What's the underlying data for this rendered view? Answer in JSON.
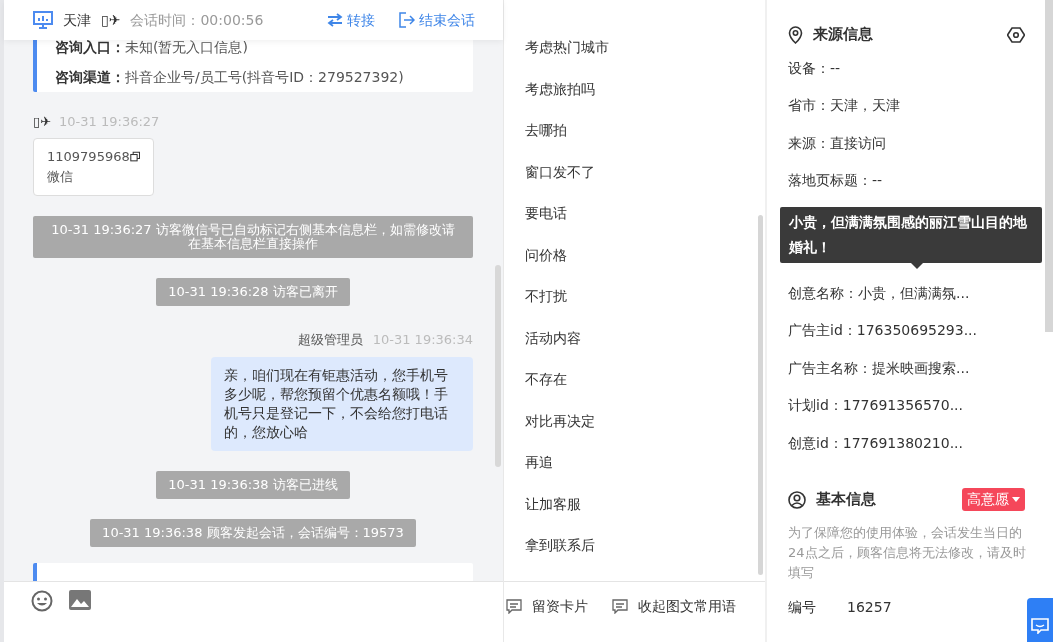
{
  "header": {
    "city": "天津",
    "visitor": "▯✈",
    "session_time": "会话时间：00:00:56",
    "actions": [
      {
        "label": "转接",
        "kind": "transfer"
      },
      {
        "label": "结束会话",
        "kind": "end"
      }
    ]
  },
  "messages": [
    {
      "kind": "info_card",
      "lines": [
        "**咨询入口：**未知(暂无入口信息)",
        "**咨询渠道：**抖音企业号/员工号(抖音号ID：279527392)"
      ]
    },
    {
      "kind": "visitor",
      "sender": "▯✈",
      "time": "10-31 19:36:27",
      "card": {
        "number": "1109795968",
        "label": "微信"
      }
    },
    {
      "kind": "system",
      "text": "10-31 19:36:27 访客微信号已自动标记右侧基本信息栏，如需修改请在基本信息栏直接操作"
    },
    {
      "kind": "system",
      "text": "10-31 19:36:28 访客已离开"
    },
    {
      "kind": "agent",
      "sender": "超级管理员",
      "time": "10-31 19:36:34",
      "text": "亲，咱们现在有钜惠活动，您手机号多少呢，帮您预留个优惠名额哦！手机号只是登记一下，不会给您打电话的，您放心哈"
    },
    {
      "kind": "system",
      "text": "10-31 19:36:38 访客已进线"
    },
    {
      "kind": "system",
      "text": "10-31 19:36:38 顾客发起会话，会话编号：19573"
    },
    {
      "kind": "info_card"
    }
  ],
  "phrases": [
    "考虑热门城市",
    "考虑旅拍吗",
    "去哪拍",
    "窗口发不了",
    "要电话",
    "问价格",
    "不打扰",
    "活动内容",
    "不存在",
    "对比再决定",
    "再追",
    "让加客服",
    "拿到联系后"
  ],
  "phrase_tools": [
    "留资卡片",
    "收起图文常用语"
  ],
  "source_info": {
    "title": "来源信息",
    "fields": [
      "设备：--",
      "省市：天津，天津",
      "来源：直接访问",
      "落地页标题：--",
      "创意名称：小贵，但满满氛...",
      "广告主id：176350695293...",
      "广告主名称：提米映画搜索...",
      "计划id：177691356570...",
      "创意id：177691380210..."
    ]
  },
  "tooltip": "小贵，但满满氛围感的丽江雪山目的地婚礼！",
  "basic_info": {
    "title": "基本信息",
    "intent": "高意愿",
    "notice": "为了保障您的使用体验，会话发生当日的24点之后，顾客信息将无法修改，请及时填写",
    "fields": [
      {
        "label": "编号",
        "value": "16257"
      }
    ]
  }
}
